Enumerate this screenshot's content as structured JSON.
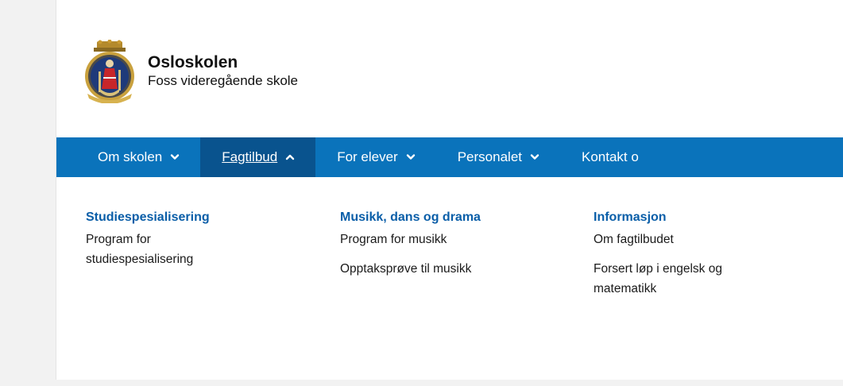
{
  "header": {
    "title": "Osloskolen",
    "subtitle": "Foss videregående skole"
  },
  "nav": {
    "items": [
      {
        "label": "Om skolen",
        "chevron": "chevron-down-icon",
        "active": false
      },
      {
        "label": "Fagtilbud",
        "chevron": "chevron-up-icon",
        "active": true
      },
      {
        "label": "For elever",
        "chevron": "chevron-down-icon",
        "active": false
      },
      {
        "label": "Personalet",
        "chevron": "chevron-down-icon",
        "active": false
      },
      {
        "label": "Kontakt o",
        "chevron": "",
        "active": false
      }
    ]
  },
  "dropdown": {
    "columns": [
      {
        "heading": "Studiespesialisering",
        "links": [
          "Program for studiespesialisering"
        ]
      },
      {
        "heading": "Musikk, dans og drama",
        "links": [
          "Program for musikk",
          "Opptaksprøve til musikk"
        ]
      },
      {
        "heading": "Informasjon",
        "links": [
          "Om fagtilbudet",
          "Forsert løp i engelsk og matematikk"
        ]
      }
    ]
  },
  "colors": {
    "nav_bg": "#0a73bb",
    "nav_active_bg": "#09538e",
    "heading_link": "#0a5ea8"
  }
}
